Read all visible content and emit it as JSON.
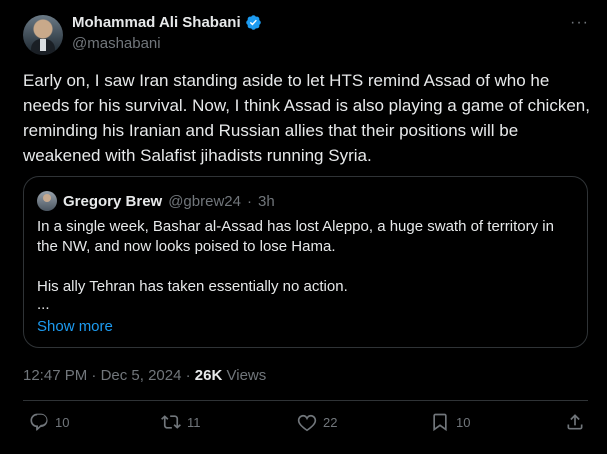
{
  "author": {
    "name": "Mohammad Ali Shabani",
    "handle": "@mashabani"
  },
  "menu": {
    "more_label": "···"
  },
  "post": {
    "text": "Early on, I saw Iran standing aside to let HTS remind Assad of who he needs for his survival. Now, I think Assad is also playing a game of chicken, reminding his Iranian and Russian allies that their positions will be weakened with Salafist jihadists running Syria."
  },
  "quote": {
    "name": "Gregory Brew",
    "handle": "@gbrew24",
    "separator": "·",
    "time": "3h",
    "paragraph1": "In a single week, Bashar al-Assad has lost Aleppo, a huge swath of territory in the NW, and now looks poised to lose Hama.",
    "paragraph2": "His ally Tehran has taken essentially no action.",
    "ellipsis": "...",
    "show_more": "Show more"
  },
  "meta": {
    "time": "12:47 PM",
    "separator1": "·",
    "date": "Dec 5, 2024",
    "separator2": "·",
    "views_count": "26K",
    "views_label": "Views"
  },
  "actions": {
    "replies": "10",
    "reposts": "11",
    "likes": "22",
    "bookmarks": "10"
  },
  "colors": {
    "background": "#000000",
    "text": "#e7e9ea",
    "muted": "#71767b",
    "accent": "#1d9bf0",
    "border": "#2f3336"
  },
  "icons": [
    "verified-badge-icon",
    "more-icon",
    "reply-icon",
    "repost-icon",
    "like-icon",
    "bookmark-icon",
    "share-icon"
  ]
}
